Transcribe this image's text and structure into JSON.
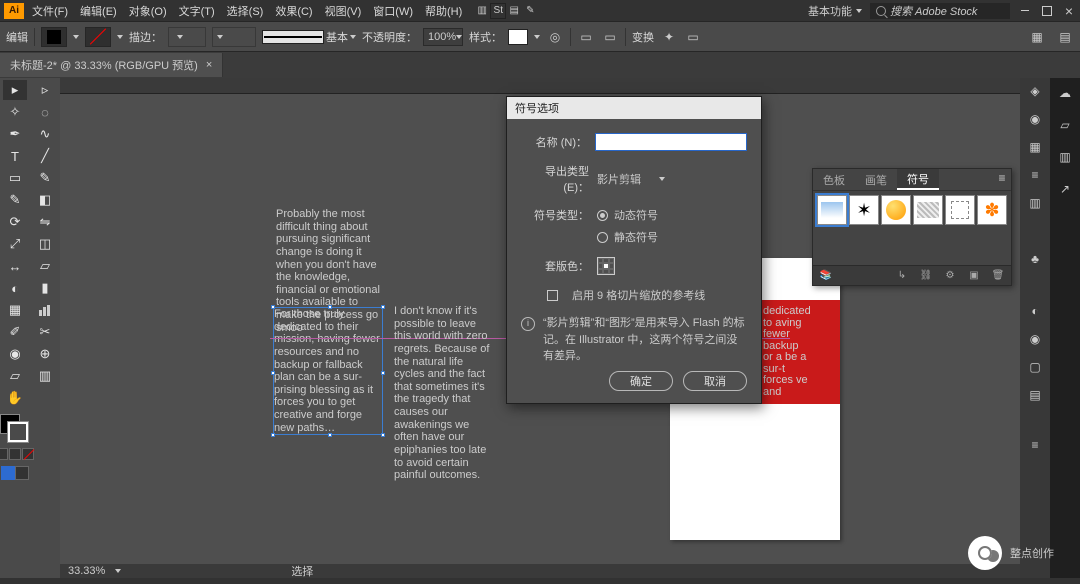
{
  "app": {
    "logo": "Ai"
  },
  "menu": {
    "file": "文件(F)",
    "edit": "编辑(E)",
    "object": "对象(O)",
    "type": "文字(T)",
    "select": "选择(S)",
    "effect": "效果(C)",
    "view": "视图(V)",
    "window": "窗口(W)",
    "help": "帮助(H)"
  },
  "workspace": "基本功能",
  "search_placeholder": "搜索 Adobe Stock",
  "control": {
    "edit": "编辑",
    "stroke_style": "描边：",
    "stroke_combo": "",
    "basic": "基本",
    "opacity": "不透明度：",
    "opacity_v": "100%",
    "style": "样式：",
    "transform": "变换"
  },
  "tab": {
    "name": "未标题-2* @ 33.33% (RGB/GPU 预览)",
    "close": "×"
  },
  "doc_text": {
    "t1": "Probably the most difficult thing about pursuing significant change is doing it when you don't have the knowledge, financial or emotional tools available to make the process go smoo",
    "t2": "For those truly dedicated to their mission, having fewer resources and no backup or fallback plan can be a sur-prising blessing as it forces you to get creative and forge new paths…",
    "t3": "I don't know if it's possible to leave this world with zero regrets.   Because of the natural life cycles and the fact that sometimes it's the tragedy that causes our awakenings we often have our epiphanies too late to avoid certain painful outcomes.",
    "t4": "dedicated to aving fewer backup or a be a sur-t forces ve and"
  },
  "dialog": {
    "title": "符号选项",
    "name": "名称 (N)：",
    "name_v": "",
    "export": "导出类型 (E)：",
    "export_v": "影片剪辑",
    "symtype": "符号类型：",
    "r1": "动态符号",
    "r2": "静态符号",
    "reg": "套版色：",
    "guides": "启用 9 格切片缩放的参考线",
    "info": "“影片剪辑”和“图形”是用来导入 Flash 的标记。在 Illustrator 中，这两个符号之间没有差异。",
    "ok": "确定",
    "cancel": "取消"
  },
  "panel": {
    "t1": "色板",
    "t2": "画笔",
    "t3": "符号",
    "foot_lbl": ""
  },
  "status": {
    "zoom": "33.33%",
    "sel": "选择"
  },
  "wm": "整点创作"
}
